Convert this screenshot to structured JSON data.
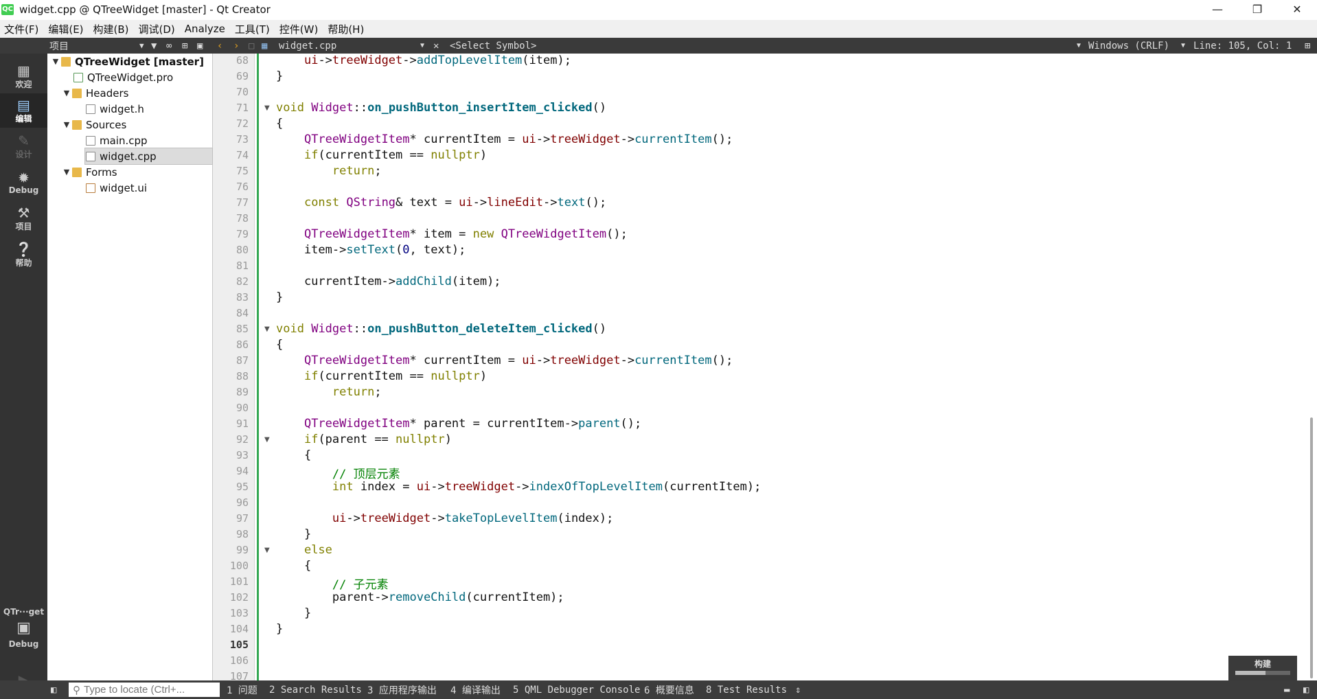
{
  "window": {
    "title": "widget.cpp @ QTreeWidget [master] - Qt Creator",
    "app_icon": "QC"
  },
  "menu": [
    "文件(F)",
    "编辑(E)",
    "构建(B)",
    "调试(D)",
    "Analyze",
    "工具(T)",
    "控件(W)",
    "帮助(H)"
  ],
  "toolbar": {
    "panel_title": "项目",
    "file_name": "widget.cpp",
    "symbol": "<Select Symbol>",
    "encoding": "Windows (CRLF)",
    "position": "Line: 105, Col: 1"
  },
  "modes": [
    {
      "label": "欢迎",
      "icon": "grid-icon"
    },
    {
      "label": "编辑",
      "icon": "edit-icon"
    },
    {
      "label": "设计",
      "icon": "pencil-icon"
    },
    {
      "label": "Debug",
      "icon": "bug-icon"
    },
    {
      "label": "项目",
      "icon": "wrench-icon"
    },
    {
      "label": "帮助",
      "icon": "help-icon"
    }
  ],
  "kit": {
    "name": "QTr···get",
    "mode": "Debug"
  },
  "tree": [
    {
      "label": "QTreeWidget [master]",
      "level": 0,
      "expanded": true,
      "kind": "project"
    },
    {
      "label": "QTreeWidget.pro",
      "level": 1,
      "kind": "pro"
    },
    {
      "label": "Headers",
      "level": 1,
      "expanded": true,
      "kind": "folder"
    },
    {
      "label": "widget.h",
      "level": 2,
      "kind": "file"
    },
    {
      "label": "Sources",
      "level": 1,
      "expanded": true,
      "kind": "folder"
    },
    {
      "label": "main.cpp",
      "level": 2,
      "kind": "file"
    },
    {
      "label": "widget.cpp",
      "level": 2,
      "kind": "file",
      "selected": true
    },
    {
      "label": "Forms",
      "level": 1,
      "expanded": true,
      "kind": "folder"
    },
    {
      "label": "widget.ui",
      "level": 2,
      "kind": "ui"
    }
  ],
  "editor": {
    "current_line": 105,
    "fold_lines": [
      71,
      85,
      92,
      99
    ],
    "lines": [
      {
        "n": 68,
        "t": [
          [
            "    ",
            ""
          ],
          [
            "ui",
            "mem"
          ],
          [
            "->",
            ""
          ],
          [
            "treeWidget",
            "mem"
          ],
          [
            "->",
            ""
          ],
          [
            "addTopLevelItem",
            "fn"
          ],
          [
            "(item);",
            ""
          ]
        ]
      },
      {
        "n": 69,
        "t": [
          [
            "}",
            ""
          ]
        ]
      },
      {
        "n": 70,
        "t": []
      },
      {
        "n": 71,
        "t": [
          [
            "void",
            "kw"
          ],
          [
            " ",
            ""
          ],
          [
            "Widget",
            "ty"
          ],
          [
            "::",
            ""
          ],
          [
            "on_pushButton_insertItem_clicked",
            "fnb"
          ],
          [
            "()",
            ""
          ]
        ]
      },
      {
        "n": 72,
        "t": [
          [
            "{",
            ""
          ]
        ]
      },
      {
        "n": 73,
        "t": [
          [
            "    ",
            ""
          ],
          [
            "QTreeWidgetItem",
            "ty"
          ],
          [
            "* currentItem = ",
            ""
          ],
          [
            "ui",
            "mem"
          ],
          [
            "->",
            ""
          ],
          [
            "treeWidget",
            "mem"
          ],
          [
            "->",
            ""
          ],
          [
            "currentItem",
            "fn"
          ],
          [
            "();",
            ""
          ]
        ]
      },
      {
        "n": 74,
        "t": [
          [
            "    ",
            ""
          ],
          [
            "if",
            "kw"
          ],
          [
            "(currentItem == ",
            ""
          ],
          [
            "nullptr",
            "kw"
          ],
          [
            ")",
            ""
          ]
        ]
      },
      {
        "n": 75,
        "t": [
          [
            "        ",
            ""
          ],
          [
            "return",
            "kw"
          ],
          [
            ";",
            ""
          ]
        ]
      },
      {
        "n": 76,
        "t": []
      },
      {
        "n": 77,
        "t": [
          [
            "    ",
            ""
          ],
          [
            "const",
            "kw"
          ],
          [
            " ",
            ""
          ],
          [
            "QString",
            "ty"
          ],
          [
            "& text = ",
            ""
          ],
          [
            "ui",
            "mem"
          ],
          [
            "->",
            ""
          ],
          [
            "lineEdit",
            "mem"
          ],
          [
            "->",
            ""
          ],
          [
            "text",
            "fn"
          ],
          [
            "();",
            ""
          ]
        ]
      },
      {
        "n": 78,
        "t": []
      },
      {
        "n": 79,
        "t": [
          [
            "    ",
            ""
          ],
          [
            "QTreeWidgetItem",
            "ty"
          ],
          [
            "* item = ",
            ""
          ],
          [
            "new",
            "kw"
          ],
          [
            " ",
            ""
          ],
          [
            "QTreeWidgetItem",
            "ty"
          ],
          [
            "();",
            ""
          ]
        ]
      },
      {
        "n": 80,
        "t": [
          [
            "    item->",
            ""
          ],
          [
            "setText",
            "fn"
          ],
          [
            "(",
            ""
          ],
          [
            "0",
            "num"
          ],
          [
            ", text);",
            ""
          ]
        ]
      },
      {
        "n": 81,
        "t": []
      },
      {
        "n": 82,
        "t": [
          [
            "    currentItem->",
            ""
          ],
          [
            "addChild",
            "fn"
          ],
          [
            "(item);",
            ""
          ]
        ]
      },
      {
        "n": 83,
        "t": [
          [
            "}",
            ""
          ]
        ]
      },
      {
        "n": 84,
        "t": []
      },
      {
        "n": 85,
        "t": [
          [
            "void",
            "kw"
          ],
          [
            " ",
            ""
          ],
          [
            "Widget",
            "ty"
          ],
          [
            "::",
            ""
          ],
          [
            "on_pushButton_deleteItem_clicked",
            "fnb"
          ],
          [
            "()",
            ""
          ]
        ]
      },
      {
        "n": 86,
        "t": [
          [
            "{",
            ""
          ]
        ]
      },
      {
        "n": 87,
        "t": [
          [
            "    ",
            ""
          ],
          [
            "QTreeWidgetItem",
            "ty"
          ],
          [
            "* currentItem = ",
            ""
          ],
          [
            "ui",
            "mem"
          ],
          [
            "->",
            ""
          ],
          [
            "treeWidget",
            "mem"
          ],
          [
            "->",
            ""
          ],
          [
            "currentItem",
            "fn"
          ],
          [
            "();",
            ""
          ]
        ]
      },
      {
        "n": 88,
        "t": [
          [
            "    ",
            ""
          ],
          [
            "if",
            "kw"
          ],
          [
            "(currentItem == ",
            ""
          ],
          [
            "nullptr",
            "kw"
          ],
          [
            ")",
            ""
          ]
        ]
      },
      {
        "n": 89,
        "t": [
          [
            "        ",
            ""
          ],
          [
            "return",
            "kw"
          ],
          [
            ";",
            ""
          ]
        ]
      },
      {
        "n": 90,
        "t": []
      },
      {
        "n": 91,
        "t": [
          [
            "    ",
            ""
          ],
          [
            "QTreeWidgetItem",
            "ty"
          ],
          [
            "* parent = currentItem->",
            ""
          ],
          [
            "parent",
            "fn"
          ],
          [
            "();",
            ""
          ]
        ]
      },
      {
        "n": 92,
        "t": [
          [
            "    ",
            ""
          ],
          [
            "if",
            "kw"
          ],
          [
            "(parent == ",
            ""
          ],
          [
            "nullptr",
            "kw"
          ],
          [
            ")",
            ""
          ]
        ]
      },
      {
        "n": 93,
        "t": [
          [
            "    {",
            ""
          ]
        ]
      },
      {
        "n": 94,
        "t": [
          [
            "        ",
            ""
          ],
          [
            "// 顶层元素",
            "cm"
          ]
        ]
      },
      {
        "n": 95,
        "t": [
          [
            "        ",
            ""
          ],
          [
            "int",
            "kw"
          ],
          [
            " index = ",
            ""
          ],
          [
            "ui",
            "mem"
          ],
          [
            "->",
            ""
          ],
          [
            "treeWidget",
            "mem"
          ],
          [
            "->",
            ""
          ],
          [
            "indexOfTopLevelItem",
            "fn"
          ],
          [
            "(currentItem);",
            ""
          ]
        ]
      },
      {
        "n": 96,
        "t": []
      },
      {
        "n": 97,
        "t": [
          [
            "        ",
            ""
          ],
          [
            "ui",
            "mem"
          ],
          [
            "->",
            ""
          ],
          [
            "treeWidget",
            "mem"
          ],
          [
            "->",
            ""
          ],
          [
            "takeTopLevelItem",
            "fn"
          ],
          [
            "(index);",
            ""
          ]
        ]
      },
      {
        "n": 98,
        "t": [
          [
            "    }",
            ""
          ]
        ]
      },
      {
        "n": 99,
        "t": [
          [
            "    ",
            ""
          ],
          [
            "else",
            "kw"
          ]
        ]
      },
      {
        "n": 100,
        "t": [
          [
            "    {",
            ""
          ]
        ]
      },
      {
        "n": 101,
        "t": [
          [
            "        ",
            ""
          ],
          [
            "// 子元素",
            "cm"
          ]
        ]
      },
      {
        "n": 102,
        "t": [
          [
            "        parent->",
            ""
          ],
          [
            "removeChild",
            "fn"
          ],
          [
            "(currentItem);",
            ""
          ]
        ]
      },
      {
        "n": 103,
        "t": [
          [
            "    }",
            ""
          ]
        ]
      },
      {
        "n": 104,
        "t": [
          [
            "}",
            ""
          ]
        ]
      },
      {
        "n": 105,
        "t": []
      },
      {
        "n": 106,
        "t": []
      },
      {
        "n": 107,
        "t": []
      }
    ]
  },
  "build": {
    "label": "构建",
    "progress": 0.55
  },
  "statusbar": {
    "locator_placeholder": "Type to locate (Ctrl+...",
    "panes": [
      "1 问题",
      "2 Search Results",
      "3 应用程序输出",
      "4 编译输出",
      "5 QML Debugger Console",
      "6 概要信息",
      "8 Test Results"
    ]
  },
  "colors": {
    "keyword": "#808000",
    "type": "#800080",
    "function": "#00677c",
    "member": "#800000",
    "comment": "#008000",
    "number": "#000080",
    "change_bar": "#34a853"
  }
}
